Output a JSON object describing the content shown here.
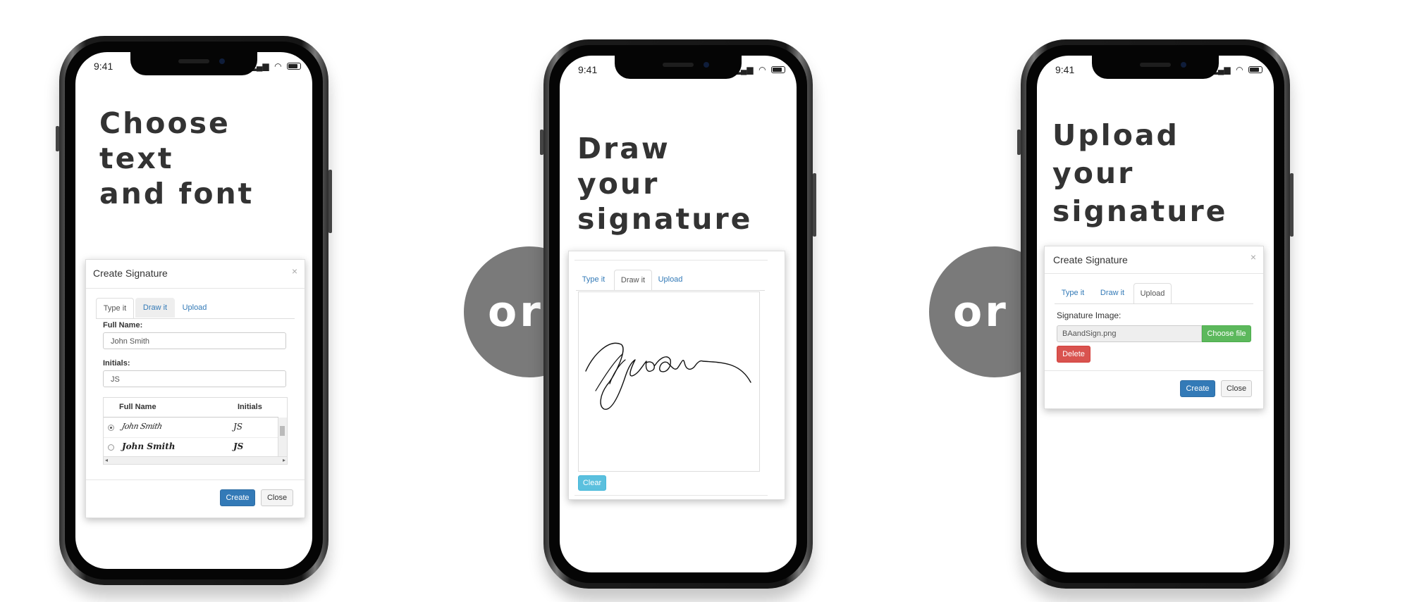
{
  "or_label": "or",
  "status_time": "9:41",
  "phone1": {
    "headline": [
      "Choose",
      "text",
      "and font"
    ],
    "dialog": {
      "title": "Create Signature",
      "close_glyph": "×",
      "tabs": [
        "Type it",
        "Draw it",
        "Upload"
      ],
      "full_name_label": "Full Name:",
      "full_name_value": "John Smith",
      "initials_label": "Initials:",
      "initials_value": "JS",
      "table_headers": [
        "Full Name",
        "Initials"
      ],
      "rows": [
        {
          "name": "John Smith",
          "initials": "JS",
          "selected": true
        },
        {
          "name": "John Smith",
          "initials": "JS",
          "selected": false
        }
      ],
      "create_label": "Create",
      "close_label": "Close"
    }
  },
  "phone2": {
    "headline": [
      "Draw",
      "your",
      "signature"
    ],
    "dialog": {
      "tabs": [
        "Type it",
        "Draw it",
        "Upload"
      ],
      "clear_label": "Clear"
    }
  },
  "phone3": {
    "headline": [
      "Upload",
      "your",
      "signature"
    ],
    "dialog": {
      "title": "Create Signature",
      "close_glyph": "×",
      "tabs": [
        "Type it",
        "Draw it",
        "Upload"
      ],
      "image_label": "Signature Image:",
      "file_name": "BAandSign.png",
      "choose_file_label": "Choose file",
      "delete_label": "Delete",
      "create_label": "Create",
      "close_label": "Close"
    }
  },
  "icons": [
    "signal-bars-icon",
    "wifi-icon",
    "battery-icon",
    "close-icon",
    "radio-icon",
    "scroll-arrow-icon"
  ],
  "colors": {
    "primary": "#337ab7",
    "info": "#5bc0de",
    "success": "#5cb85c",
    "danger": "#d9534f",
    "or_circle": "#7a7a7a",
    "headline": "#333333"
  }
}
